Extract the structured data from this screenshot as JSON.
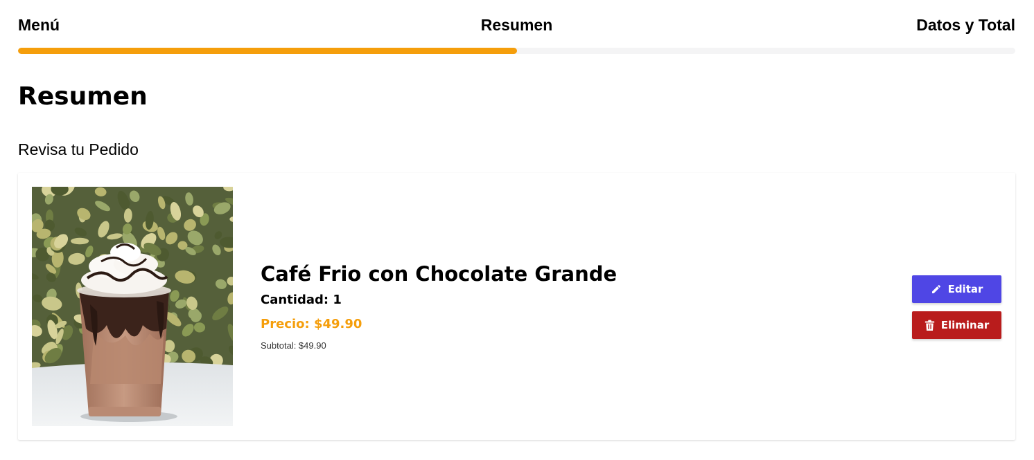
{
  "steps": [
    {
      "label": "Menú"
    },
    {
      "label": "Resumen"
    },
    {
      "label": "Datos y Total"
    }
  ],
  "progress": {
    "percent": 50,
    "color": "#f59e0b"
  },
  "page": {
    "title": "Resumen",
    "subtitle": "Revisa tu Pedido"
  },
  "order_item": {
    "image": "iced-chocolate-coffee-photo",
    "name": "Café Frio con Chocolate Grande",
    "quantity_text": "Cantidad: 1",
    "price_text": "Precio: $49.90",
    "subtotal_text": "Subtotal: $49.90",
    "edit_button": {
      "label": "Editar",
      "icon": "pencil-icon",
      "color": "#4f46e5"
    },
    "delete_button": {
      "label": "Eliminar",
      "icon": "trash-icon",
      "color": "#b91c1c"
    }
  },
  "colors": {
    "accent": "#f59e0b",
    "track": "#f4f4f5"
  }
}
